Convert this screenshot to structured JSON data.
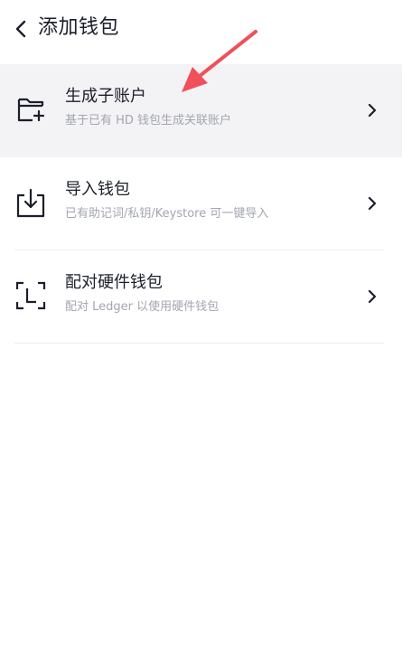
{
  "header": {
    "title": "添加钱包",
    "back_icon": "chevron-left-icon"
  },
  "items": [
    {
      "label": "生成子账户",
      "desc": "基于已有 HD 钱包生成关联账户",
      "icon": "folder-add-icon",
      "highlighted": true
    },
    {
      "label": "导入钱包",
      "desc": "已有助记词/私钥/Keystore 可一键导入",
      "icon": "download-tray-icon",
      "highlighted": false
    },
    {
      "label": "配对硬件钱包",
      "desc": "配对 Ledger 以使用硬件钱包",
      "icon": "scan-frame-icon",
      "highlighted": false
    }
  ],
  "colors": {
    "text_primary": "#1c1f2a",
    "text_secondary": "#a3a6b0",
    "highlight_bg": "#f3f3f5",
    "annotation_arrow": "#f0505a"
  },
  "annotation": {
    "arrow_icon": "pointer-arrow-icon"
  }
}
